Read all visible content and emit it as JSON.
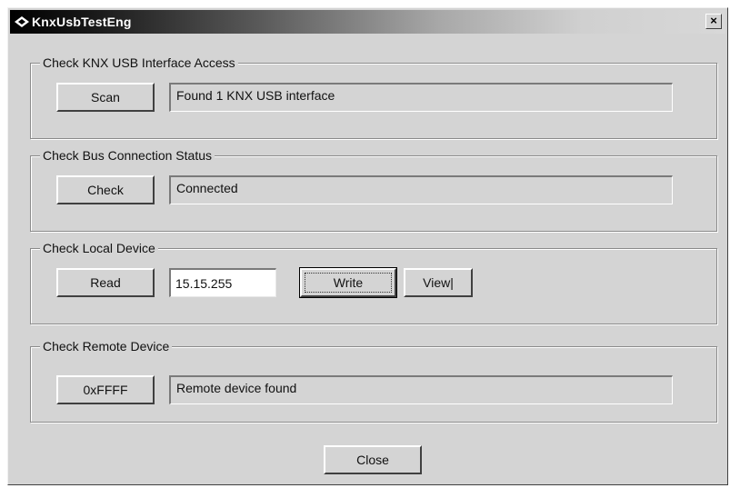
{
  "window": {
    "title": "KnxUsbTestEng",
    "close_glyph": "×"
  },
  "groups": {
    "usb_access": {
      "legend": "Check KNX USB Interface Access",
      "button_label": "Scan",
      "status_text": "Found 1 KNX USB interface"
    },
    "bus_connection": {
      "legend": "Check Bus Connection Status",
      "button_label": "Check",
      "status_text": "Connected"
    },
    "local_device": {
      "legend": "Check Local Device",
      "read_label": "Read",
      "address_value": "15.15.255",
      "write_label": "Write",
      "view_label": "View|"
    },
    "remote_device": {
      "legend": "Check Remote Device",
      "button_label": "0xFFFF",
      "status_text": "Remote device found"
    }
  },
  "footer": {
    "close_label": "Close"
  },
  "icons": {
    "title_icon": "knx-logo-icon",
    "close_icon": "close-icon"
  }
}
